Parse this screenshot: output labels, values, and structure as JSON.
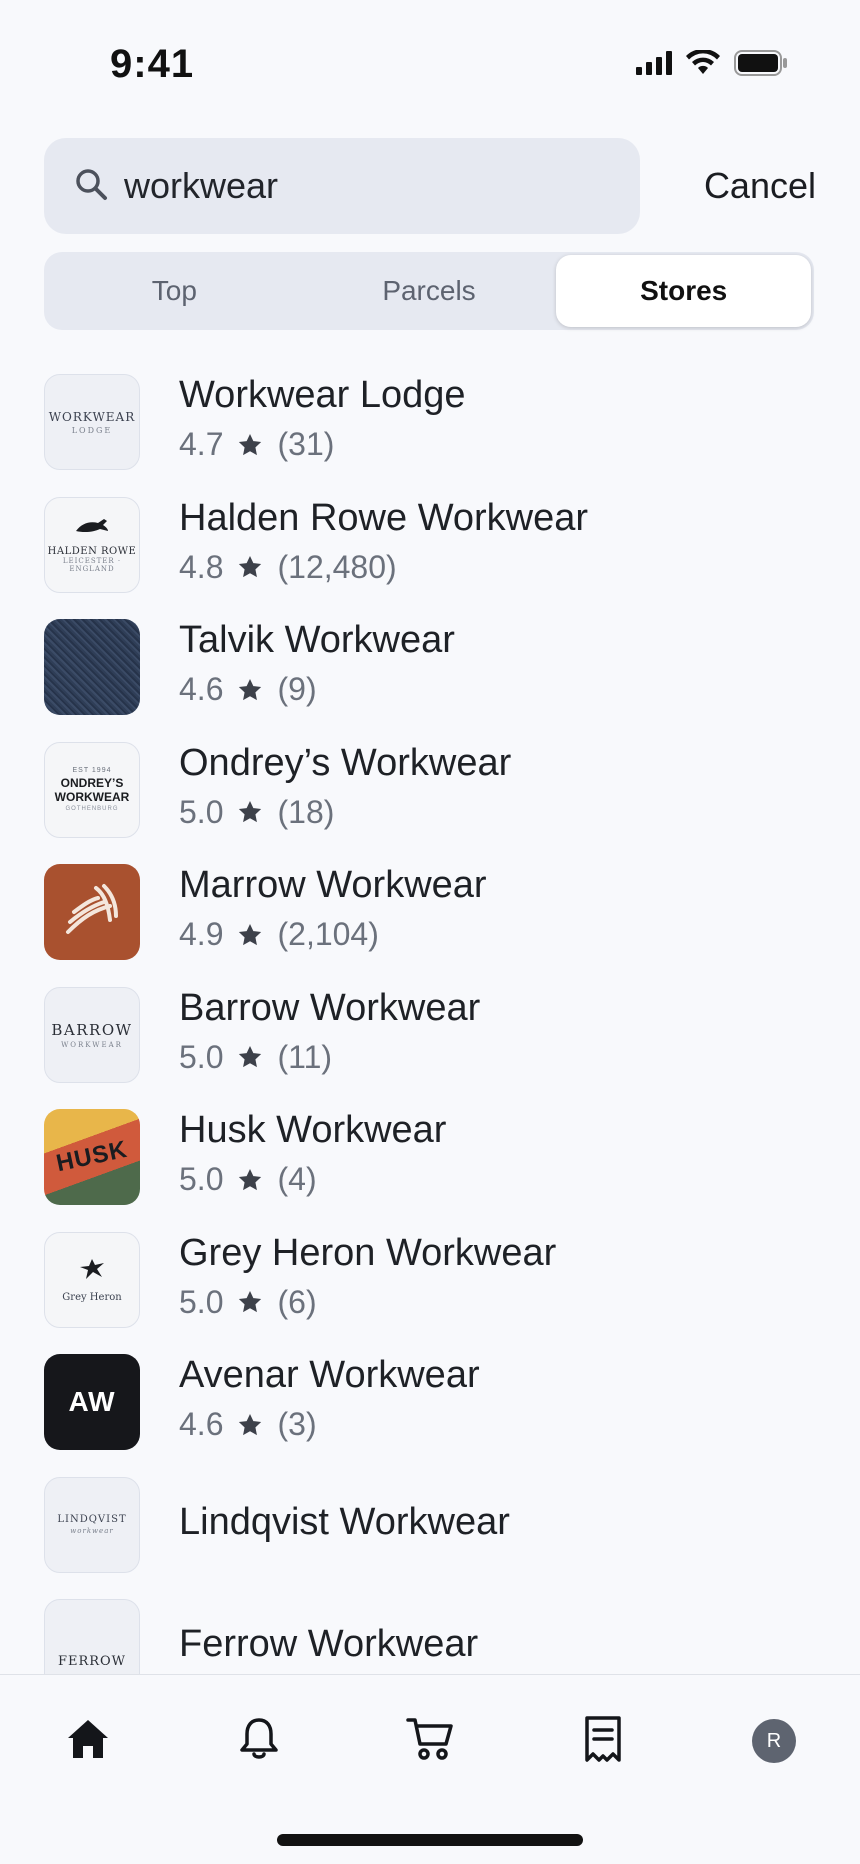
{
  "status": {
    "time": "9:41",
    "icons": [
      "cellular-icon",
      "wifi-icon",
      "battery-icon"
    ]
  },
  "search": {
    "value": "workwear",
    "cancel_label": "Cancel"
  },
  "segments": [
    {
      "label": "Top",
      "active": false
    },
    {
      "label": "Parcels",
      "active": false
    },
    {
      "label": "Stores",
      "active": true
    }
  ],
  "stores": [
    {
      "name": "Workwear Lodge",
      "rating": "4.7",
      "count": "(31)",
      "logo_lines": [
        "WORKWEAR",
        "LODGE"
      ]
    },
    {
      "name": "Halden Rowe Workwear",
      "rating": "4.8",
      "count": "(12,480)",
      "logo_lines": [
        "HALDEN ROWE",
        "LEICESTER ·",
        "ENGLAND"
      ]
    },
    {
      "name": "Talvik Workwear",
      "rating": "4.6",
      "count": "(9)",
      "logo_lines": []
    },
    {
      "name": "Ondrey’s Workwear",
      "rating": "5.0",
      "count": "(18)",
      "logo_lines": [
        "EST 1994",
        "ONDREY’S",
        "WORKWEAR",
        "GOTHENBURG"
      ]
    },
    {
      "name": "Marrow Workwear",
      "rating": "4.9",
      "count": "(2,104)",
      "logo_lines": []
    },
    {
      "name": "Barrow Workwear",
      "rating": "5.0",
      "count": "(11)",
      "logo_lines": [
        "BARROW",
        "WORKWEAR"
      ]
    },
    {
      "name": "Husk Workwear",
      "rating": "5.0",
      "count": "(4)",
      "logo_lines": [
        "HUSK"
      ]
    },
    {
      "name": "Grey Heron Workwear",
      "rating": "5.0",
      "count": "(6)",
      "logo_lines": [
        "Grey Heron"
      ]
    },
    {
      "name": "Avenar Workwear",
      "rating": "4.6",
      "count": "(3)",
      "logo_lines": [
        "AW"
      ]
    },
    {
      "name": "Lindqvist Workwear",
      "rating": "",
      "count": "",
      "logo_lines": [
        "LINDQVIST",
        "workwear"
      ]
    },
    {
      "name": "Ferrow Workwear",
      "rating": "",
      "count": "",
      "logo_lines": [
        "FERROW"
      ]
    }
  ],
  "tabbar": {
    "avatar_initial": "R",
    "icons": [
      "home-icon",
      "bell-icon",
      "cart-icon",
      "receipt-icon",
      "avatar"
    ]
  },
  "colors": {
    "background": "#f8f9fc",
    "search_bg": "#e6e9f1",
    "star": "#3d414a",
    "avatar": "#5e6470"
  }
}
